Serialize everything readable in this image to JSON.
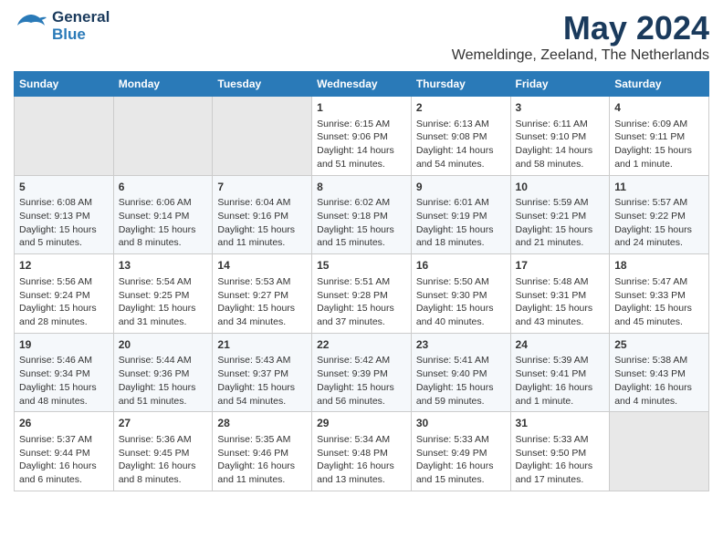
{
  "header": {
    "logo_general": "General",
    "logo_blue": "Blue",
    "title": "May 2024",
    "subtitle": "Wemeldinge, Zeeland, The Netherlands"
  },
  "calendar": {
    "days_of_week": [
      "Sunday",
      "Monday",
      "Tuesday",
      "Wednesday",
      "Thursday",
      "Friday",
      "Saturday"
    ],
    "weeks": [
      [
        {
          "day": "",
          "empty": true
        },
        {
          "day": "",
          "empty": true
        },
        {
          "day": "",
          "empty": true
        },
        {
          "day": "1",
          "line1": "Sunrise: 6:15 AM",
          "line2": "Sunset: 9:06 PM",
          "line3": "Daylight: 14 hours",
          "line4": "and 51 minutes."
        },
        {
          "day": "2",
          "line1": "Sunrise: 6:13 AM",
          "line2": "Sunset: 9:08 PM",
          "line3": "Daylight: 14 hours",
          "line4": "and 54 minutes."
        },
        {
          "day": "3",
          "line1": "Sunrise: 6:11 AM",
          "line2": "Sunset: 9:10 PM",
          "line3": "Daylight: 14 hours",
          "line4": "and 58 minutes."
        },
        {
          "day": "4",
          "line1": "Sunrise: 6:09 AM",
          "line2": "Sunset: 9:11 PM",
          "line3": "Daylight: 15 hours",
          "line4": "and 1 minute."
        }
      ],
      [
        {
          "day": "5",
          "line1": "Sunrise: 6:08 AM",
          "line2": "Sunset: 9:13 PM",
          "line3": "Daylight: 15 hours",
          "line4": "and 5 minutes."
        },
        {
          "day": "6",
          "line1": "Sunrise: 6:06 AM",
          "line2": "Sunset: 9:14 PM",
          "line3": "Daylight: 15 hours",
          "line4": "and 8 minutes."
        },
        {
          "day": "7",
          "line1": "Sunrise: 6:04 AM",
          "line2": "Sunset: 9:16 PM",
          "line3": "Daylight: 15 hours",
          "line4": "and 11 minutes."
        },
        {
          "day": "8",
          "line1": "Sunrise: 6:02 AM",
          "line2": "Sunset: 9:18 PM",
          "line3": "Daylight: 15 hours",
          "line4": "and 15 minutes."
        },
        {
          "day": "9",
          "line1": "Sunrise: 6:01 AM",
          "line2": "Sunset: 9:19 PM",
          "line3": "Daylight: 15 hours",
          "line4": "and 18 minutes."
        },
        {
          "day": "10",
          "line1": "Sunrise: 5:59 AM",
          "line2": "Sunset: 9:21 PM",
          "line3": "Daylight: 15 hours",
          "line4": "and 21 minutes."
        },
        {
          "day": "11",
          "line1": "Sunrise: 5:57 AM",
          "line2": "Sunset: 9:22 PM",
          "line3": "Daylight: 15 hours",
          "line4": "and 24 minutes."
        }
      ],
      [
        {
          "day": "12",
          "line1": "Sunrise: 5:56 AM",
          "line2": "Sunset: 9:24 PM",
          "line3": "Daylight: 15 hours",
          "line4": "and 28 minutes."
        },
        {
          "day": "13",
          "line1": "Sunrise: 5:54 AM",
          "line2": "Sunset: 9:25 PM",
          "line3": "Daylight: 15 hours",
          "line4": "and 31 minutes."
        },
        {
          "day": "14",
          "line1": "Sunrise: 5:53 AM",
          "line2": "Sunset: 9:27 PM",
          "line3": "Daylight: 15 hours",
          "line4": "and 34 minutes."
        },
        {
          "day": "15",
          "line1": "Sunrise: 5:51 AM",
          "line2": "Sunset: 9:28 PM",
          "line3": "Daylight: 15 hours",
          "line4": "and 37 minutes."
        },
        {
          "day": "16",
          "line1": "Sunrise: 5:50 AM",
          "line2": "Sunset: 9:30 PM",
          "line3": "Daylight: 15 hours",
          "line4": "and 40 minutes."
        },
        {
          "day": "17",
          "line1": "Sunrise: 5:48 AM",
          "line2": "Sunset: 9:31 PM",
          "line3": "Daylight: 15 hours",
          "line4": "and 43 minutes."
        },
        {
          "day": "18",
          "line1": "Sunrise: 5:47 AM",
          "line2": "Sunset: 9:33 PM",
          "line3": "Daylight: 15 hours",
          "line4": "and 45 minutes."
        }
      ],
      [
        {
          "day": "19",
          "line1": "Sunrise: 5:46 AM",
          "line2": "Sunset: 9:34 PM",
          "line3": "Daylight: 15 hours",
          "line4": "and 48 minutes."
        },
        {
          "day": "20",
          "line1": "Sunrise: 5:44 AM",
          "line2": "Sunset: 9:36 PM",
          "line3": "Daylight: 15 hours",
          "line4": "and 51 minutes."
        },
        {
          "day": "21",
          "line1": "Sunrise: 5:43 AM",
          "line2": "Sunset: 9:37 PM",
          "line3": "Daylight: 15 hours",
          "line4": "and 54 minutes."
        },
        {
          "day": "22",
          "line1": "Sunrise: 5:42 AM",
          "line2": "Sunset: 9:39 PM",
          "line3": "Daylight: 15 hours",
          "line4": "and 56 minutes."
        },
        {
          "day": "23",
          "line1": "Sunrise: 5:41 AM",
          "line2": "Sunset: 9:40 PM",
          "line3": "Daylight: 15 hours",
          "line4": "and 59 minutes."
        },
        {
          "day": "24",
          "line1": "Sunrise: 5:39 AM",
          "line2": "Sunset: 9:41 PM",
          "line3": "Daylight: 16 hours",
          "line4": "and 1 minute."
        },
        {
          "day": "25",
          "line1": "Sunrise: 5:38 AM",
          "line2": "Sunset: 9:43 PM",
          "line3": "Daylight: 16 hours",
          "line4": "and 4 minutes."
        }
      ],
      [
        {
          "day": "26",
          "line1": "Sunrise: 5:37 AM",
          "line2": "Sunset: 9:44 PM",
          "line3": "Daylight: 16 hours",
          "line4": "and 6 minutes."
        },
        {
          "day": "27",
          "line1": "Sunrise: 5:36 AM",
          "line2": "Sunset: 9:45 PM",
          "line3": "Daylight: 16 hours",
          "line4": "and 8 minutes."
        },
        {
          "day": "28",
          "line1": "Sunrise: 5:35 AM",
          "line2": "Sunset: 9:46 PM",
          "line3": "Daylight: 16 hours",
          "line4": "and 11 minutes."
        },
        {
          "day": "29",
          "line1": "Sunrise: 5:34 AM",
          "line2": "Sunset: 9:48 PM",
          "line3": "Daylight: 16 hours",
          "line4": "and 13 minutes."
        },
        {
          "day": "30",
          "line1": "Sunrise: 5:33 AM",
          "line2": "Sunset: 9:49 PM",
          "line3": "Daylight: 16 hours",
          "line4": "and 15 minutes."
        },
        {
          "day": "31",
          "line1": "Sunrise: 5:33 AM",
          "line2": "Sunset: 9:50 PM",
          "line3": "Daylight: 16 hours",
          "line4": "and 17 minutes."
        },
        {
          "day": "",
          "empty": true
        }
      ]
    ]
  }
}
